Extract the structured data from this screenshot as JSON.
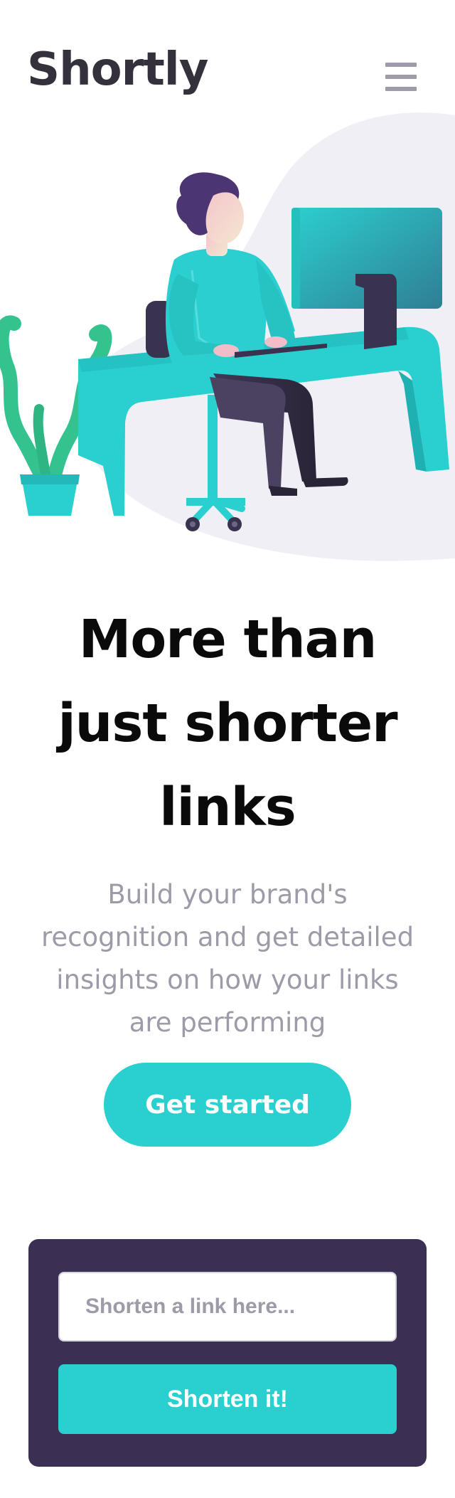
{
  "header": {
    "logo": "Shortly",
    "menu_icon": "hamburger-menu-icon"
  },
  "hero": {
    "illustration": "person-working-at-desk-illustration",
    "title_lines": [
      "More than",
      "just shorter",
      "links"
    ],
    "subtitle_lines": [
      "Build your brand's",
      "recognition and get detailed",
      "insights on how your links",
      "are performing"
    ],
    "cta_label": "Get started"
  },
  "shorten": {
    "placeholder": "Shorten a link here...",
    "value": "",
    "button_label": "Shorten it!"
  },
  "colors": {
    "primary": "#2acfcf",
    "dark_violet": "#3b3054",
    "grayish_violet": "#9e9aa7",
    "very_dark_blue": "#34313d"
  }
}
